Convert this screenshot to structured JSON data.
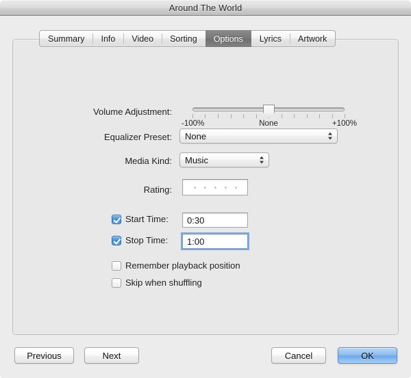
{
  "window": {
    "title": "Around The World"
  },
  "tabs": [
    {
      "label": "Summary",
      "selected": false
    },
    {
      "label": "Info",
      "selected": false
    },
    {
      "label": "Video",
      "selected": false
    },
    {
      "label": "Sorting",
      "selected": false
    },
    {
      "label": "Options",
      "selected": true
    },
    {
      "label": "Lyrics",
      "selected": false
    },
    {
      "label": "Artwork",
      "selected": false
    }
  ],
  "form": {
    "volume": {
      "label": "Volume Adjustment:",
      "min_label": "-100%",
      "mid_label": "None",
      "max_label": "+100%",
      "value_percent": 50,
      "tick_count": 13
    },
    "equalizer": {
      "label": "Equalizer Preset:",
      "value": "None"
    },
    "media_kind": {
      "label": "Media Kind:",
      "value": "Music"
    },
    "rating": {
      "label": "Rating:",
      "stars": 0,
      "star_slots": 5
    },
    "start_time": {
      "label": "Start Time:",
      "checked": true,
      "value": "0:30",
      "focused": false
    },
    "stop_time": {
      "label": "Stop Time:",
      "checked": true,
      "value": "1:00",
      "focused": true
    },
    "remember_position": {
      "label": "Remember playback position",
      "checked": false
    },
    "skip_shuffling": {
      "label": "Skip when shuffling",
      "checked": false
    }
  },
  "buttons": {
    "previous": "Previous",
    "next": "Next",
    "cancel": "Cancel",
    "ok": "OK"
  },
  "colors": {
    "accent_blue": "#4d91dd",
    "default_button_blue": "#8fbdf0",
    "selected_tab_gray": "#787878",
    "window_background": "#ececec",
    "panel_background": "#e8e8e8"
  }
}
